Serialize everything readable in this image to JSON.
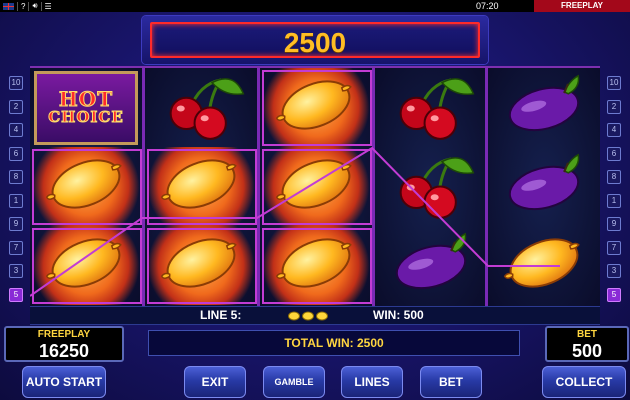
{
  "status_bar": {
    "icons": [
      "uk-flag-icon",
      "help-icon",
      "sound-icon",
      "menu-icon"
    ],
    "help_glyph": "?",
    "clock": "07:20",
    "mode_label": "FREEPLAY"
  },
  "win_display": {
    "value": "2500"
  },
  "reels": {
    "columns": [
      [
        "hot-choice",
        "lemon",
        "lemon"
      ],
      [
        "cherry",
        "lemon",
        "lemon"
      ],
      [
        "lemon",
        "lemon",
        "lemon"
      ],
      [
        "cherry",
        "cherry",
        "plum"
      ],
      [
        "plum",
        "plum",
        "lemon"
      ]
    ],
    "glowing": [
      [
        0,
        1
      ],
      [
        0,
        2
      ],
      [
        1,
        1
      ],
      [
        1,
        2
      ],
      [
        2,
        0
      ],
      [
        2,
        1
      ],
      [
        2,
        2
      ]
    ],
    "hot_choice_text": [
      "HOT",
      "CHOICE"
    ]
  },
  "line_markers": {
    "left": [
      "10",
      "2",
      "4",
      "6",
      "8",
      "1",
      "9",
      "7",
      "3",
      "5"
    ],
    "right": [
      "10",
      "2",
      "4",
      "6",
      "8",
      "1",
      "9",
      "7",
      "3",
      "5"
    ],
    "active": "5"
  },
  "info_bar": {
    "line_text": "LINE 5:",
    "lemon_count": 3,
    "win_text": "WIN: 500"
  },
  "credit": {
    "label": "FREEPLAY",
    "value": "16250"
  },
  "bet": {
    "label": "BET",
    "value": "500"
  },
  "total_win": "TOTAL WIN: 2500",
  "buttons": {
    "auto_start": "AUTO START",
    "exit": "EXIT",
    "gamble": "GAMBLE",
    "lines": "LINES",
    "bet": "BET",
    "collect": "COLLECT"
  },
  "colors": {
    "accent_red": "#ff2a2a",
    "win_gold": "#ffbe24",
    "line_purple": "#c23cd4",
    "button_blue": "#283aa6"
  }
}
